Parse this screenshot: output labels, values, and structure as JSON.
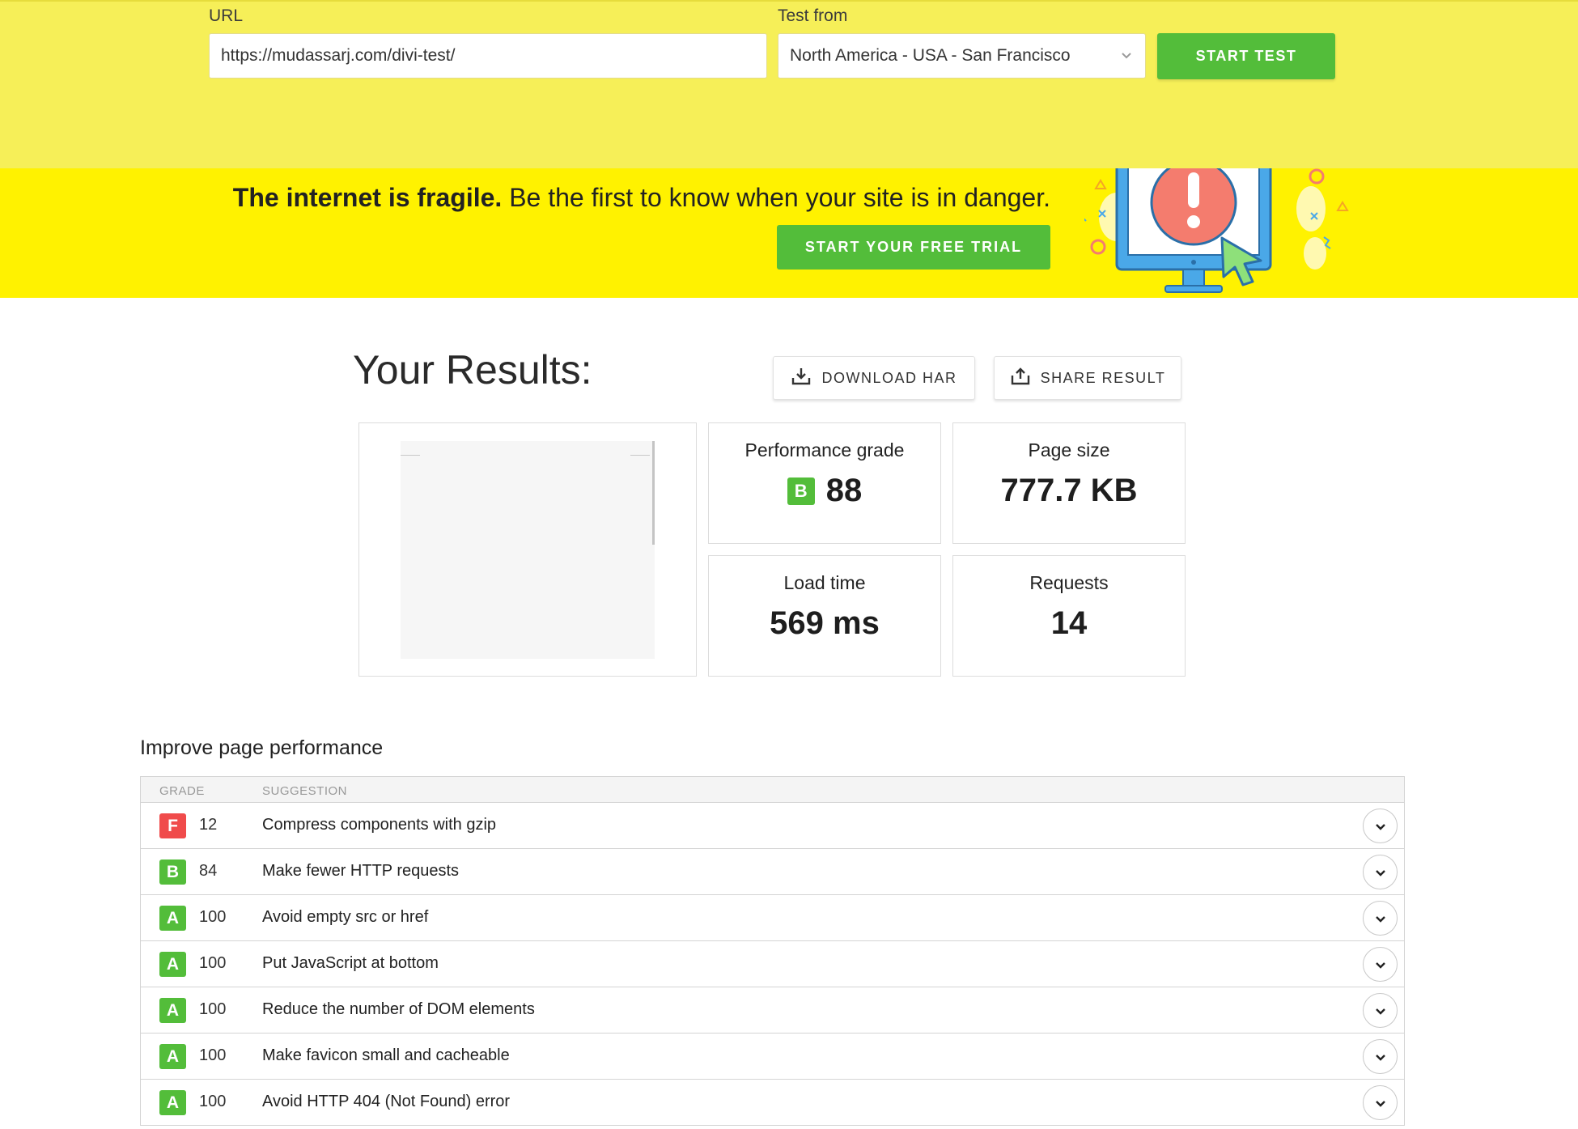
{
  "form": {
    "url_label": "URL",
    "url_value": "https://mudassarj.com/divi-test/",
    "test_from_label": "Test from",
    "test_from_value": "North America - USA - San Francisco",
    "start_button": "START TEST"
  },
  "banner": {
    "headline_bold": "The internet is fragile.",
    "headline_rest": " Be the first to know when your site is in danger.",
    "cta": "START YOUR FREE TRIAL"
  },
  "results": {
    "title": "Your Results:",
    "download_har": "DOWNLOAD HAR",
    "share_result": "SHARE RESULT",
    "metrics": {
      "performance_grade": {
        "label": "Performance grade",
        "grade": "B",
        "value": "88"
      },
      "page_size": {
        "label": "Page size",
        "value": "777.7 KB"
      },
      "load_time": {
        "label": "Load time",
        "value": "569 ms"
      },
      "requests": {
        "label": "Requests",
        "value": "14"
      }
    }
  },
  "improve": {
    "title": "Improve page performance",
    "headers": {
      "grade": "GRADE",
      "suggestion": "SUGGESTION"
    },
    "rows": [
      {
        "grade": "F",
        "score": "12",
        "suggestion": "Compress components with gzip"
      },
      {
        "grade": "B",
        "score": "84",
        "suggestion": "Make fewer HTTP requests"
      },
      {
        "grade": "A",
        "score": "100",
        "suggestion": "Avoid empty src or href"
      },
      {
        "grade": "A",
        "score": "100",
        "suggestion": "Put JavaScript at bottom"
      },
      {
        "grade": "A",
        "score": "100",
        "suggestion": "Reduce the number of DOM elements"
      },
      {
        "grade": "A",
        "score": "100",
        "suggestion": "Make favicon small and cacheable"
      },
      {
        "grade": "A",
        "score": "100",
        "suggestion": "Avoid HTTP 404 (Not Found) error"
      }
    ]
  },
  "colors": {
    "form_bg": "#f6ef58",
    "banner_bg": "#fff200",
    "accent_green": "#53bd3a",
    "grade_A": "#53bd3a",
    "grade_B": "#53bd3a",
    "grade_F": "#f04b4b"
  },
  "icons": {
    "select_chevron": "chevron-down-icon",
    "download": "download-icon",
    "share": "share-icon",
    "row_expand": "chevron-down-icon",
    "banner_illustration": "monitor-alert-illustration"
  }
}
